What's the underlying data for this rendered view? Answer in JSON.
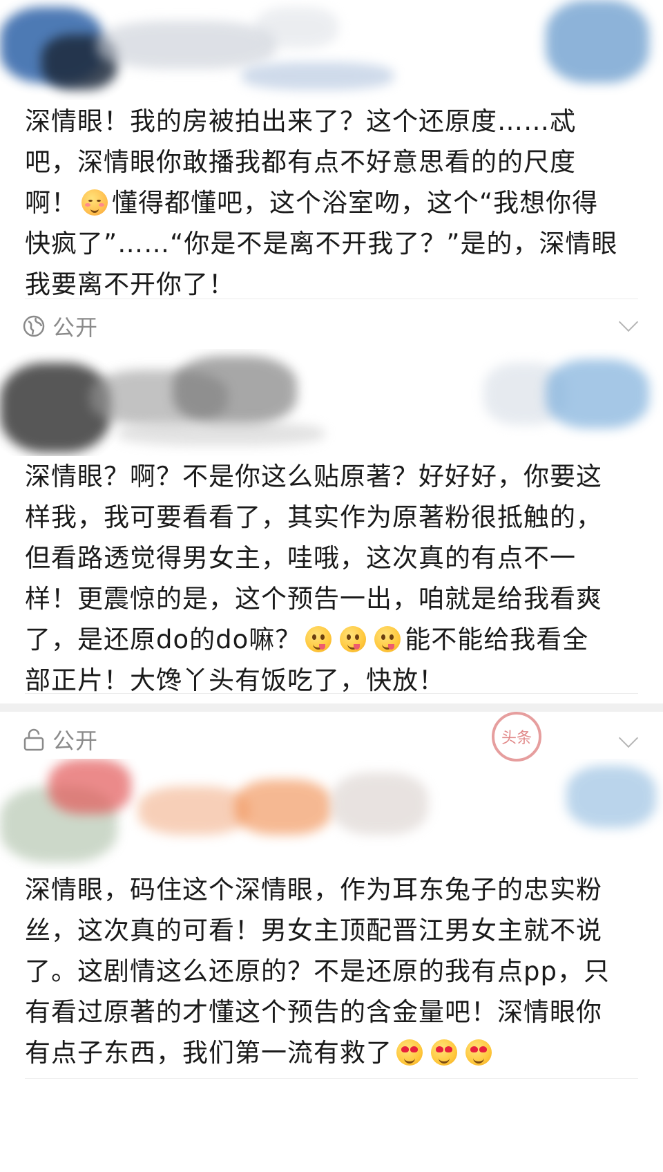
{
  "posts": [
    {
      "lines": [
        "深情眼！我的房被拍出来了？这个还原度……忒",
        "吧，深情眼你敢播我都有点不好意思看的的尺度",
        "啊！{shy}懂得都懂吧，这个浴室吻，这个“我想你得",
        "快疯了”……“你是不是离不开我了？”是的，深情眼",
        "我要离不开你了！"
      ],
      "line1": "深情眼！我的房被拍出来了？这个还原度……忒",
      "line2": "吧，深情眼你敢播我都有点不好意思看的的尺度",
      "line3a": "啊！",
      "line3b": "懂得都懂吧，这个浴室吻，这个“我想你得",
      "line4": "快疯了”……“你是不是离不开我了？”是的，深情眼",
      "line5": "我要离不开你了！",
      "visibility": "公开",
      "visibility_icon": "globe-icon"
    },
    {
      "line1": "深情眼？啊？不是你这么贴原著？好好好，你要这",
      "line2": "样我，我可要看看了，其实作为原著粉很抵触的，",
      "line3": "但看路透觉得男女主，哇哦，这次真的有点不一",
      "line4": "样！更震惊的是，这个预告一出，咱就是给我看爽",
      "line5a": "了，是还原do的do嘛？",
      "line5b": "能不能给我看全",
      "line6": "部正片！大馋丫头有饭吃了，快放！",
      "visibility": "公开",
      "visibility_icon": "lock-icon",
      "emoji": "yum-face-icon"
    },
    {
      "line1": "深情眼，码住这个深情眼，作为耳东兔子的忠实粉",
      "line2": "丝，这次真的可看！男女主顶配晋江男女主就不说",
      "line3": "了。这剧情这么还原的？不是还原的我有点pp，只",
      "line4": "有看过原著的才懂这个预告的含金量吧！深情眼你",
      "line5": "有点子东西，我们第一流有救了",
      "emoji": "heart-eyes-icon"
    }
  ],
  "stamp_text": "头条",
  "colors": {
    "text": "#1a1a1a",
    "muted": "#8a8a8a",
    "divider": "#ececec"
  }
}
